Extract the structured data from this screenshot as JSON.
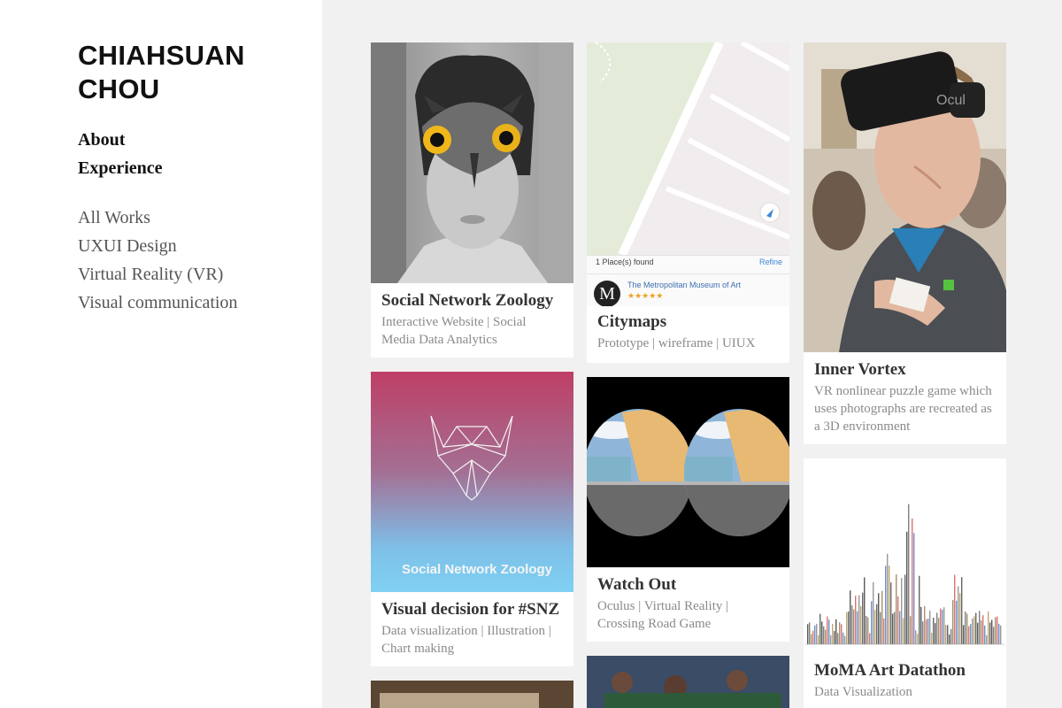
{
  "site": {
    "title_line1": "CHIAHSUAN",
    "title_line2": "CHOU"
  },
  "nav": {
    "about": "About",
    "experience": "Experience"
  },
  "categories": [
    "All Works",
    "UXUI Design",
    "Virtual Reality (VR)",
    "Visual communication"
  ],
  "projects": [
    {
      "title": "Social Network Zoology",
      "desc": "Interactive Website | Social Media Data Analytics"
    },
    {
      "title": "Citymaps",
      "desc": "Prototype | wireframe | UIUX"
    },
    {
      "title": "Inner Vortex",
      "desc": "VR nonlinear puzzle game which uses photographs are recreated as a 3D environment"
    },
    {
      "title": "Visual decision for #SNZ",
      "desc": "Data visualization | Illustration | Chart making"
    },
    {
      "title": "Watch Out",
      "desc": "Oculus | Virtual Reality | Crossing Road Game"
    },
    {
      "title": "MoMA Art Datathon",
      "desc": "Data Visualization"
    }
  ],
  "thumbs": {
    "citymaps_found": "1 Place(s) found",
    "citymaps_refine": "Refine",
    "citymaps_place": "The Metropolitan Museum of Art",
    "citymaps_stars": "★★★★★",
    "citymaps_logo": "M",
    "snz_poster_text": "Social Network Zoology",
    "vr_headset_brand": "Ocul"
  }
}
